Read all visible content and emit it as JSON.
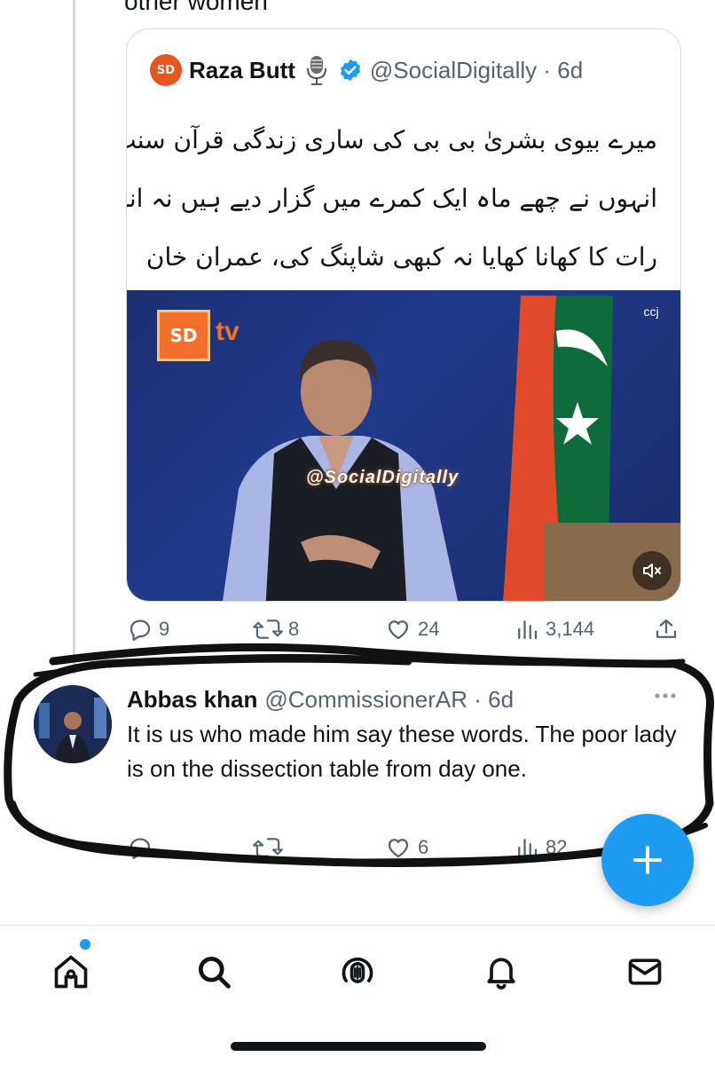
{
  "previous_tweet": {
    "cut_text": "other women"
  },
  "quote": {
    "logo_text": "SD",
    "name": "Raza Butt",
    "handle_time": "@SocialDigitally · 6d",
    "urdu_lines": [
      "میرے بیوی بشریٰ بی بی کی ساری زندگی قرآن سنت کیمطابق ہے",
      "انہوں نے چھے ماہ ایک کمرے میں گزار دیے ہیں نہ انہوں نے",
      "رات کا کھانا کھایا نہ کبھی شاپنگ کی، عمران خان"
    ],
    "media": {
      "channel_logo": "SD",
      "channel_suffix": "tv",
      "watermark": "@SocialDigitally",
      "corner_logo": "ccj"
    }
  },
  "tweet_actions": {
    "replies": "9",
    "retweets": "8",
    "likes": "24",
    "views": "3,144"
  },
  "reply": {
    "name": "Abbas khan",
    "handle_time": "@CommissionerAR · 6d",
    "text": "It is us who made him say these words. The poor lady is on the dissection table from day one.",
    "likes": "6",
    "views": "82"
  },
  "tabs": [
    "home-icon",
    "search-icon",
    "spaces-icon",
    "notifications-icon",
    "messages-icon"
  ],
  "colors": {
    "accent": "#1d9bf0",
    "muted": "#536471",
    "text": "#0f1419"
  }
}
